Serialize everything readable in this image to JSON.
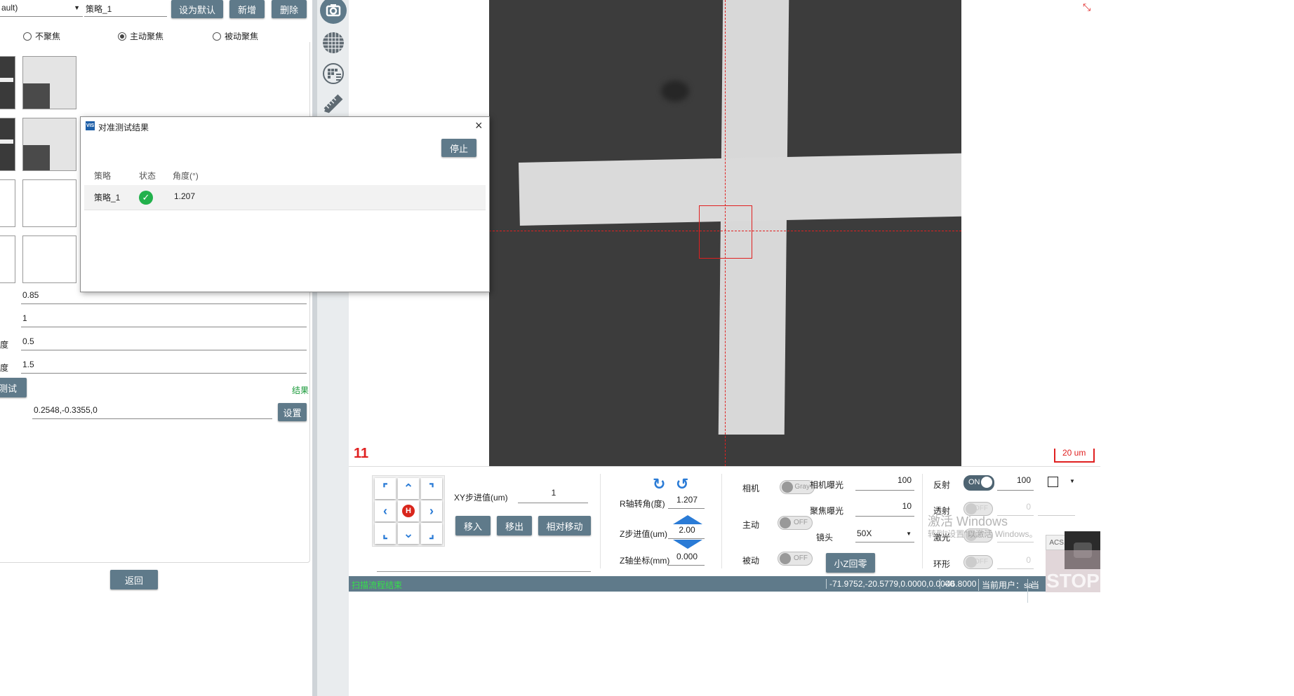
{
  "left_panel": {
    "strategy_select_value": "ault)",
    "strategy_name": "策略_1",
    "set_default_label": "设为默认",
    "add_label": "新增",
    "delete_label": "删除",
    "focus_options": [
      "不聚焦",
      "主动聚焦",
      "被动聚焦"
    ],
    "focus_selected": "主动聚焦",
    "params": [
      {
        "label": "",
        "value": "0.85"
      },
      {
        "label": "",
        "value": "1"
      },
      {
        "label": "度",
        "value": "0.5"
      },
      {
        "label": "度",
        "value": "1.5"
      }
    ],
    "test_button_label": "测试",
    "result_link": "结果",
    "offset_value": "0.2548,-0.3355,0",
    "set_button_label": "设置",
    "back_button_label": "返回"
  },
  "dialog": {
    "title": "对准测试结果",
    "app_badge": "VIS",
    "stop_label": "停止",
    "columns": [
      "策略",
      "状态",
      "角度(°)"
    ],
    "rows": [
      {
        "strategy": "策略_1",
        "status": "success",
        "angle": "1.207"
      }
    ]
  },
  "toolbar_icons": [
    "camera-icon",
    "wafer-grid-icon",
    "wafer-map-icon",
    "ruler-icon"
  ],
  "image_view": {
    "frame_number": "11",
    "scale_bar_label": "20 um"
  },
  "motion": {
    "xy_step_label": "XY步进值(um)",
    "xy_step_value": "1",
    "move_in_label": "移入",
    "move_out_label": "移出",
    "relative_move_label": "相对移动",
    "home_label": "H",
    "r_angle_label": "R轴转角(度)",
    "r_angle_value": "1.207",
    "z_step_label": "Z步进值(um)",
    "z_step_value": "2.00",
    "z_coord_label": "Z轴坐标(mm)",
    "z_coord_value": "0.000"
  },
  "camera": {
    "camera_label": "相机",
    "camera_mode": "Gray",
    "active_label": "主动",
    "active_state": "OFF",
    "passive_label": "被动",
    "passive_state": "OFF",
    "cam_exposure_label": "相机曝光",
    "cam_exposure_value": "100",
    "focus_exposure_label": "聚焦曝光",
    "focus_exposure_value": "10",
    "lens_label": "镜头",
    "lens_value": "50X",
    "small_z_zero_label": "小Z回零"
  },
  "lighting": {
    "reflect_label": "反射",
    "reflect_state": "ON",
    "reflect_value": "100",
    "transmit_label": "透射",
    "transmit_state": "OFF",
    "transmit_value": "0",
    "laser_label": "激光",
    "laser_state": "OFF",
    "ring_label": "环形",
    "ring_state": "OFF",
    "ring_value": "0"
  },
  "watermark": {
    "line1": "激活 Windows",
    "line2": "转到\"设置\"以激活 Windows。"
  },
  "acs_badge": "ACS.",
  "stop_sign": "STOP",
  "status_bar": {
    "message": "扫描流程结束",
    "coords": "-71.9752,-20.5779,0.0000,0.0000",
    "z_value": "-46.8000",
    "current_user": "当前用户：sa",
    "extra": "当前"
  },
  "colors": {
    "button": "#5f7a8a",
    "status_bar": "#5f7a8a",
    "accent_blue": "#2a7bd6",
    "crosshair": "#e02020",
    "success": "#22b14c",
    "result_green": "#1a9a3a"
  }
}
